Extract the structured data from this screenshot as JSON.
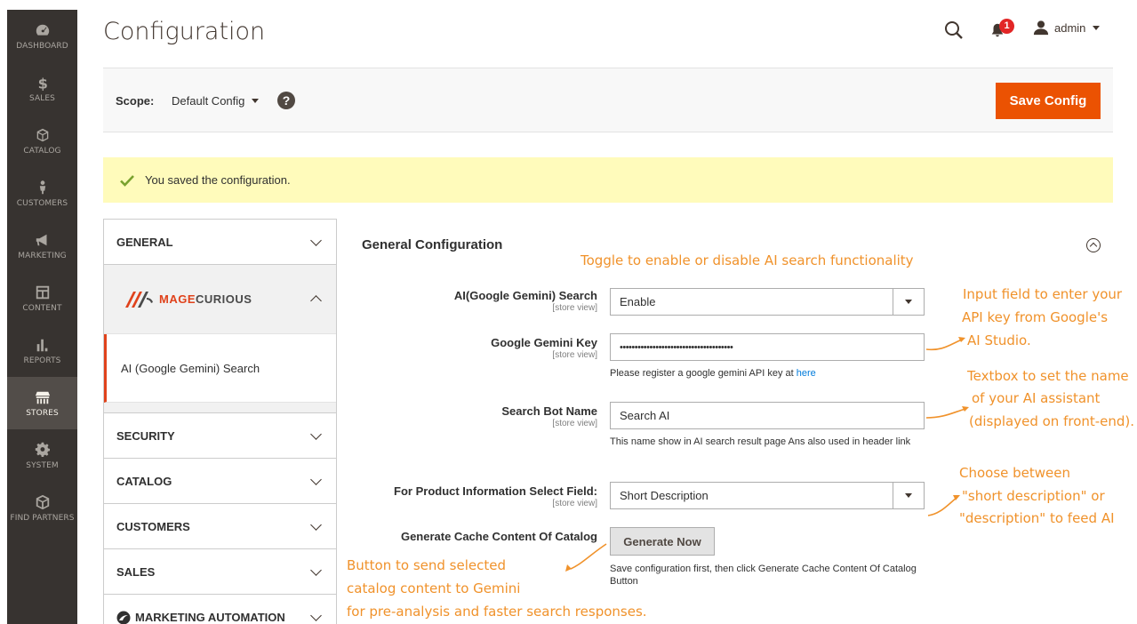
{
  "nav": {
    "items": [
      {
        "label": "DASHBOARD",
        "icon": "dashboard-icon"
      },
      {
        "label": "SALES",
        "icon": "dollar-icon"
      },
      {
        "label": "CATALOG",
        "icon": "cube-icon"
      },
      {
        "label": "CUSTOMERS",
        "icon": "person-icon"
      },
      {
        "label": "MARKETING",
        "icon": "megaphone-icon"
      },
      {
        "label": "CONTENT",
        "icon": "layout-icon"
      },
      {
        "label": "REPORTS",
        "icon": "bar-chart-icon"
      },
      {
        "label": "STORES",
        "icon": "store-icon"
      },
      {
        "label": "SYSTEM",
        "icon": "gear-icon"
      },
      {
        "label": "FIND PARTNERS",
        "icon": "box-icon"
      }
    ]
  },
  "header": {
    "title": "Configuration",
    "notification_count": "1",
    "user": "admin"
  },
  "scope": {
    "label": "Scope:",
    "value": "Default Config",
    "help": "?",
    "save_label": "Save Config"
  },
  "message": {
    "text": "You saved the configuration."
  },
  "tabs": {
    "general": "GENERAL",
    "brand_prefix": "MAGE",
    "brand_suffix": "CURIOUS",
    "sub_item": "AI (Google Gemini) Search",
    "security": "SECURITY",
    "catalog": "CATALOG",
    "customers": "CUSTOMERS",
    "sales": "SALES",
    "marketing_automation": "MARKETING AUTOMATION"
  },
  "form": {
    "section_title": "General Configuration",
    "scope_hint": "[store view]",
    "ai_search": {
      "label": "AI(Google Gemini) Search",
      "value": "Enable"
    },
    "gemini_key": {
      "label": "Google Gemini Key",
      "value": "••••••••••••••••••••••••••••••••••••••",
      "note": "Please register a google gemini API key at ",
      "note_link": "here"
    },
    "bot_name": {
      "label": "Search Bot Name",
      "value": "Search AI",
      "note": "This name show in AI search result page Ans also used in header link"
    },
    "product_field": {
      "label": "For Product Information Select Field:",
      "value": "Short Description"
    },
    "cache": {
      "label": "Generate Cache Content Of Catalog",
      "button": "Generate Now",
      "note": "Save configuration first, then click Generate Cache Content Of Catalog Button"
    }
  },
  "annotations": {
    "toggle": "Toggle to enable or disable AI search functionality",
    "key_1": "Input field to enter your",
    "key_2": "API key from Google's",
    "key_3": "AI Studio.",
    "name_1": "Textbox to set the name",
    "name_2": "of your AI assistant",
    "name_3": "(displayed on front-end).",
    "field_1": "Choose between",
    "field_2": "\"short description\" or",
    "field_3": "\"description\" to feed AI",
    "cache_1": "Button to send selected",
    "cache_2": "catalog content to Gemini",
    "cache_3": "for pre-analysis and faster search responses."
  },
  "colors": {
    "nav_bg": "#373330",
    "accent": "#eb5202",
    "message_bg": "#fffbbb",
    "annotation": "#f0922b"
  }
}
